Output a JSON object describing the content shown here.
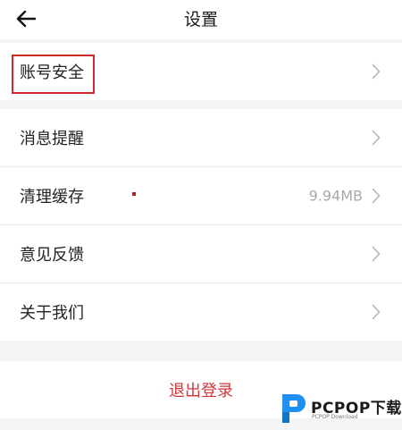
{
  "header": {
    "title": "设置",
    "back_icon": "arrow-left-icon"
  },
  "group1": {
    "items": [
      {
        "label": "账号安全",
        "value": "",
        "icon": "chevron-right-icon"
      }
    ]
  },
  "group2": {
    "items": [
      {
        "label": "消息提醒",
        "value": "",
        "icon": "chevron-right-icon"
      },
      {
        "label": "清理缓存",
        "value": "9.94MB",
        "icon": "chevron-right-icon"
      },
      {
        "label": "意见反馈",
        "value": "",
        "icon": "chevron-right-icon"
      },
      {
        "label": "关于我们",
        "value": "",
        "icon": "chevron-right-icon"
      }
    ]
  },
  "logout": {
    "label": "退出登录"
  },
  "watermark": {
    "brand": "PCPOP下载",
    "sub": "PCPOP Download"
  },
  "colors": {
    "logout_text": "#d0373a",
    "highlight_border": "#d12a2a",
    "brand_blue": "#1f8ff0"
  }
}
